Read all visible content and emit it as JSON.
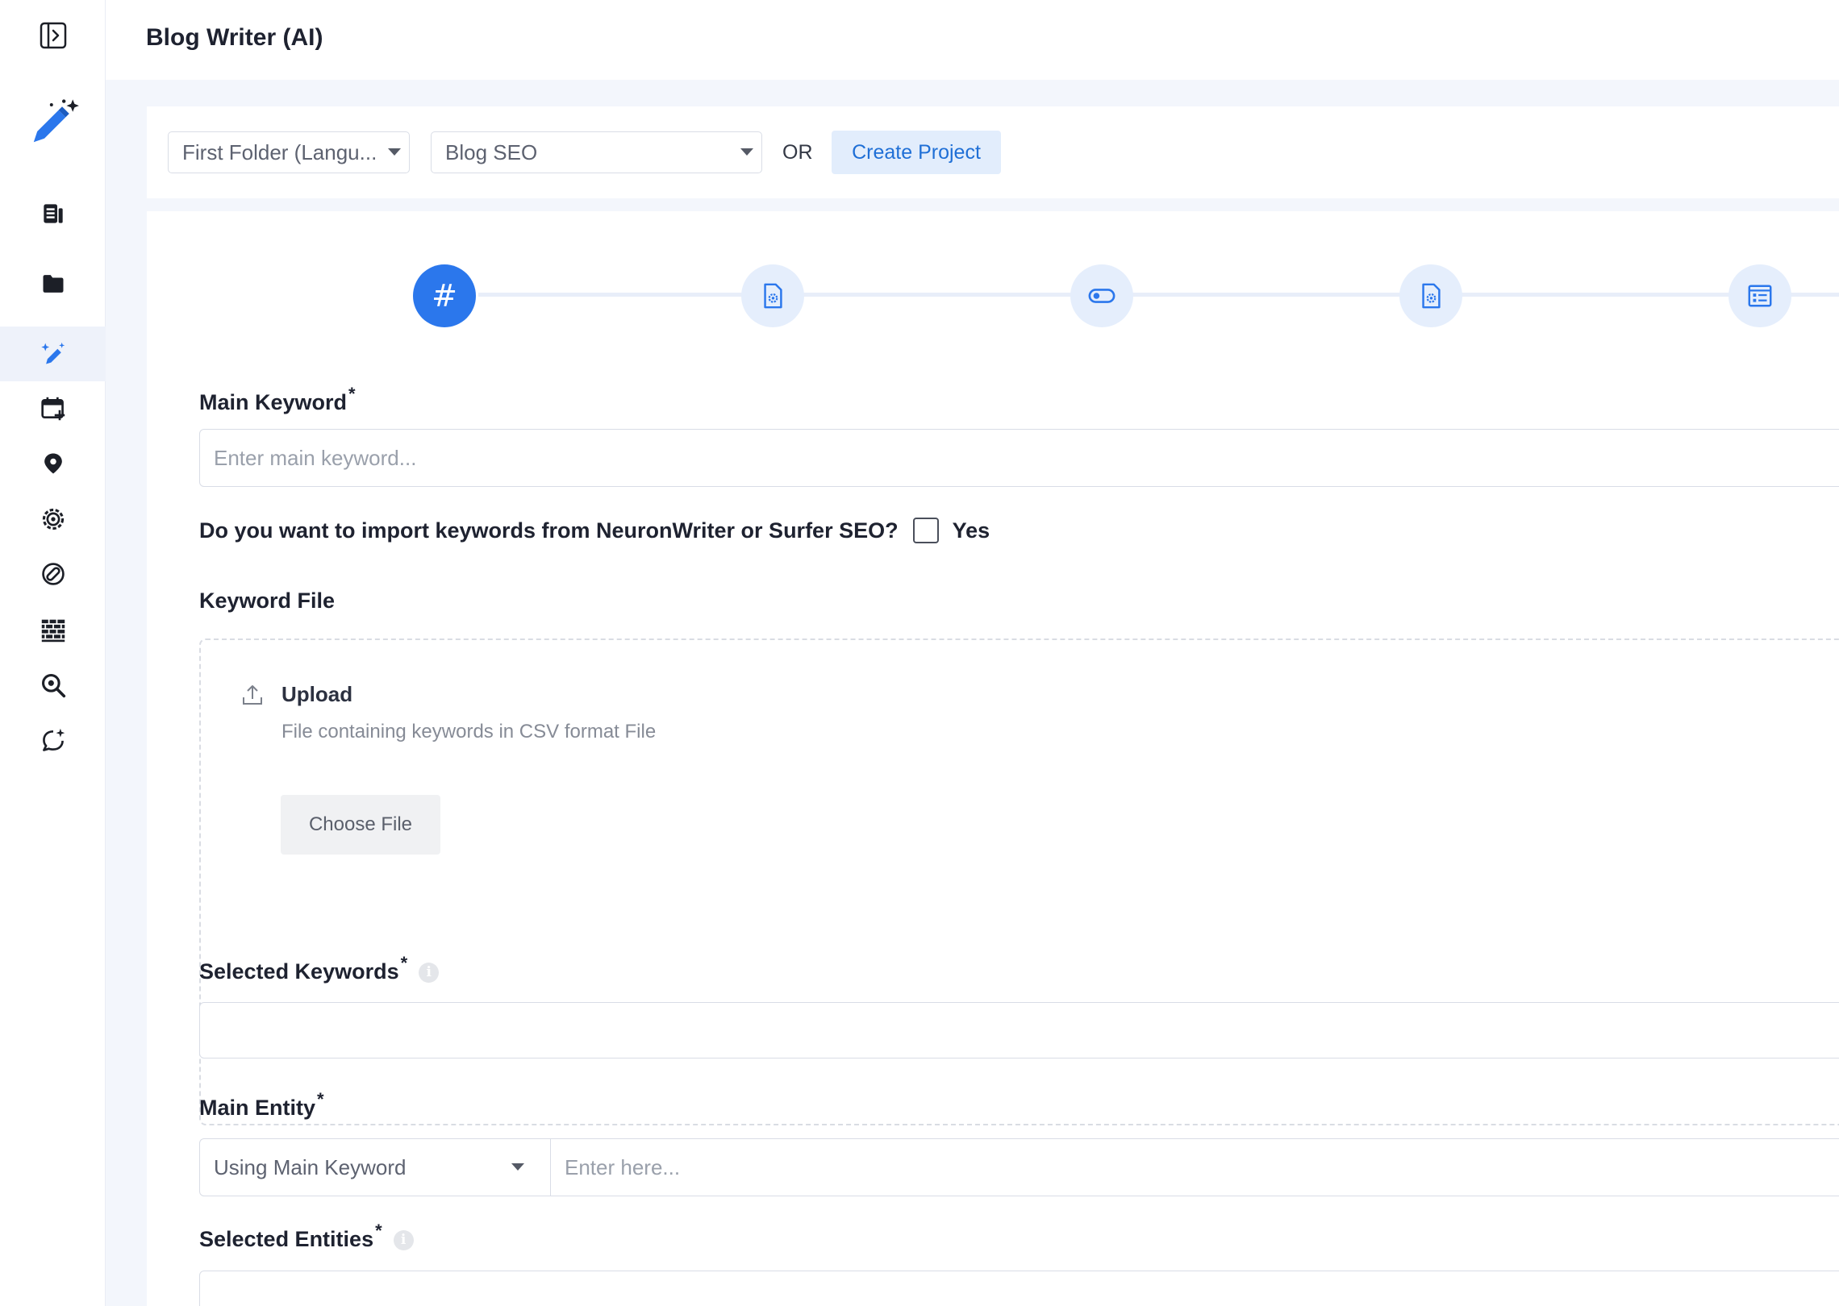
{
  "header": {
    "title": "Blog Writer (AI)"
  },
  "sidebar": {
    "items": [
      {
        "icon": "sidebar-toggle-icon"
      },
      {
        "icon": "magic-pen-icon"
      },
      {
        "icon": "article-icon"
      },
      {
        "icon": "folder-icon"
      },
      {
        "icon": "ai-writer-icon",
        "active": true
      },
      {
        "icon": "calendar-add-icon"
      },
      {
        "icon": "location-pin-icon"
      },
      {
        "icon": "settings-cog-icon"
      },
      {
        "icon": "link-icon"
      },
      {
        "icon": "brick-wall-icon"
      },
      {
        "icon": "search-analyze-icon"
      },
      {
        "icon": "chat-sparkle-icon"
      }
    ]
  },
  "project_bar": {
    "folder_select": "First Folder (Langu...",
    "project_select": "Blog SEO",
    "or_label": "OR",
    "create_project": "Create Project"
  },
  "stepper": {
    "current_step_symbol": "#",
    "steps": [
      "hashtag-icon",
      "document-settings-icon",
      "toggle-icon",
      "document-settings-icon",
      "list-document-icon"
    ]
  },
  "form": {
    "main_keyword": {
      "label": "Main Keyword",
      "required": "*",
      "placeholder": "Enter main keyword..."
    },
    "import_question": {
      "label": "Do you want to import keywords from NeuronWriter or Surfer SEO?",
      "option": "Yes"
    },
    "keyword_file": {
      "label": "Keyword File",
      "upload_title": "Upload",
      "upload_description": "File containing keywords in CSV format File",
      "choose_button": "Choose File"
    },
    "selected_keywords": {
      "label": "Selected Keywords",
      "required": "*",
      "info": "i"
    },
    "main_entity": {
      "label": "Main Entity",
      "required": "*",
      "select_value": "Using Main Keyword",
      "placeholder": "Enter here..."
    },
    "selected_entities": {
      "label": "Selected Entities",
      "required": "*",
      "info": "i"
    }
  },
  "colors": {
    "accent": "#2b77ec",
    "step_bg": "#e5eefc",
    "page_bg": "#f3f6fc"
  }
}
